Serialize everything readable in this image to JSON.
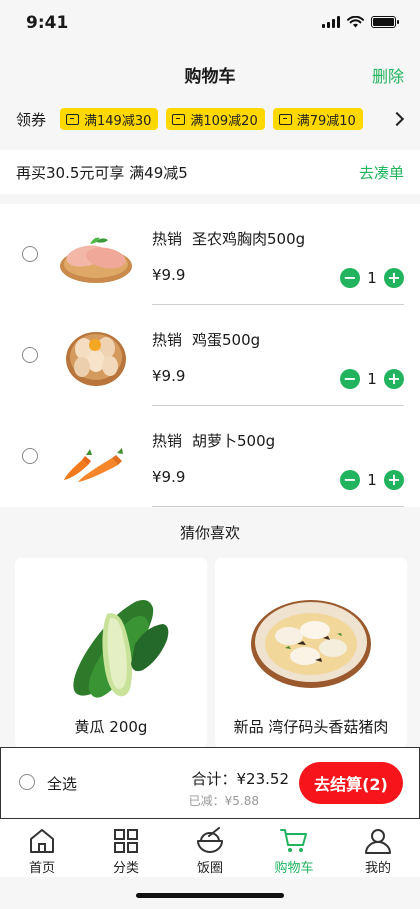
{
  "status": {
    "time": "9:41"
  },
  "nav": {
    "title": "购物车",
    "delete_label": "删除"
  },
  "coupons": {
    "label": "领券",
    "items": [
      "满149减30",
      "满109减20",
      "满79减10"
    ]
  },
  "promo": {
    "text": "再买30.5元可享 满49减5",
    "link": "去凑单"
  },
  "cart": {
    "items": [
      {
        "tag": "热销",
        "name": "圣农鸡胸肉500g",
        "price": "¥9.9",
        "qty": "1",
        "icon": "chicken-breast"
      },
      {
        "tag": "热销",
        "name": "鸡蛋500g",
        "price": "¥9.9",
        "qty": "1",
        "icon": "eggs"
      },
      {
        "tag": "热销",
        "name": "胡萝卜500g",
        "price": "¥9.9",
        "qty": "1",
        "icon": "carrots"
      }
    ]
  },
  "recommend": {
    "title": "猜你喜欢",
    "items": [
      {
        "name": "黄瓜 200g",
        "icon": "cucumbers"
      },
      {
        "name": "新品 湾仔码头香菇猪肉",
        "icon": "dumplings"
      }
    ]
  },
  "checkout": {
    "select_all": "全选",
    "total": "合计：¥23.52",
    "saved": "已减：¥5.88",
    "button": "去结算(2)"
  },
  "tabbar": {
    "items": [
      {
        "label": "首页",
        "icon": "home-icon"
      },
      {
        "label": "分类",
        "icon": "grid-icon"
      },
      {
        "label": "饭圈",
        "icon": "bowl-icon"
      },
      {
        "label": "购物车",
        "icon": "cart-icon",
        "active": true
      },
      {
        "label": "我的",
        "icon": "user-icon"
      }
    ]
  },
  "colors": {
    "accent": "#22b35e",
    "checkout": "#f5151b",
    "coupon": "#ffd800"
  }
}
